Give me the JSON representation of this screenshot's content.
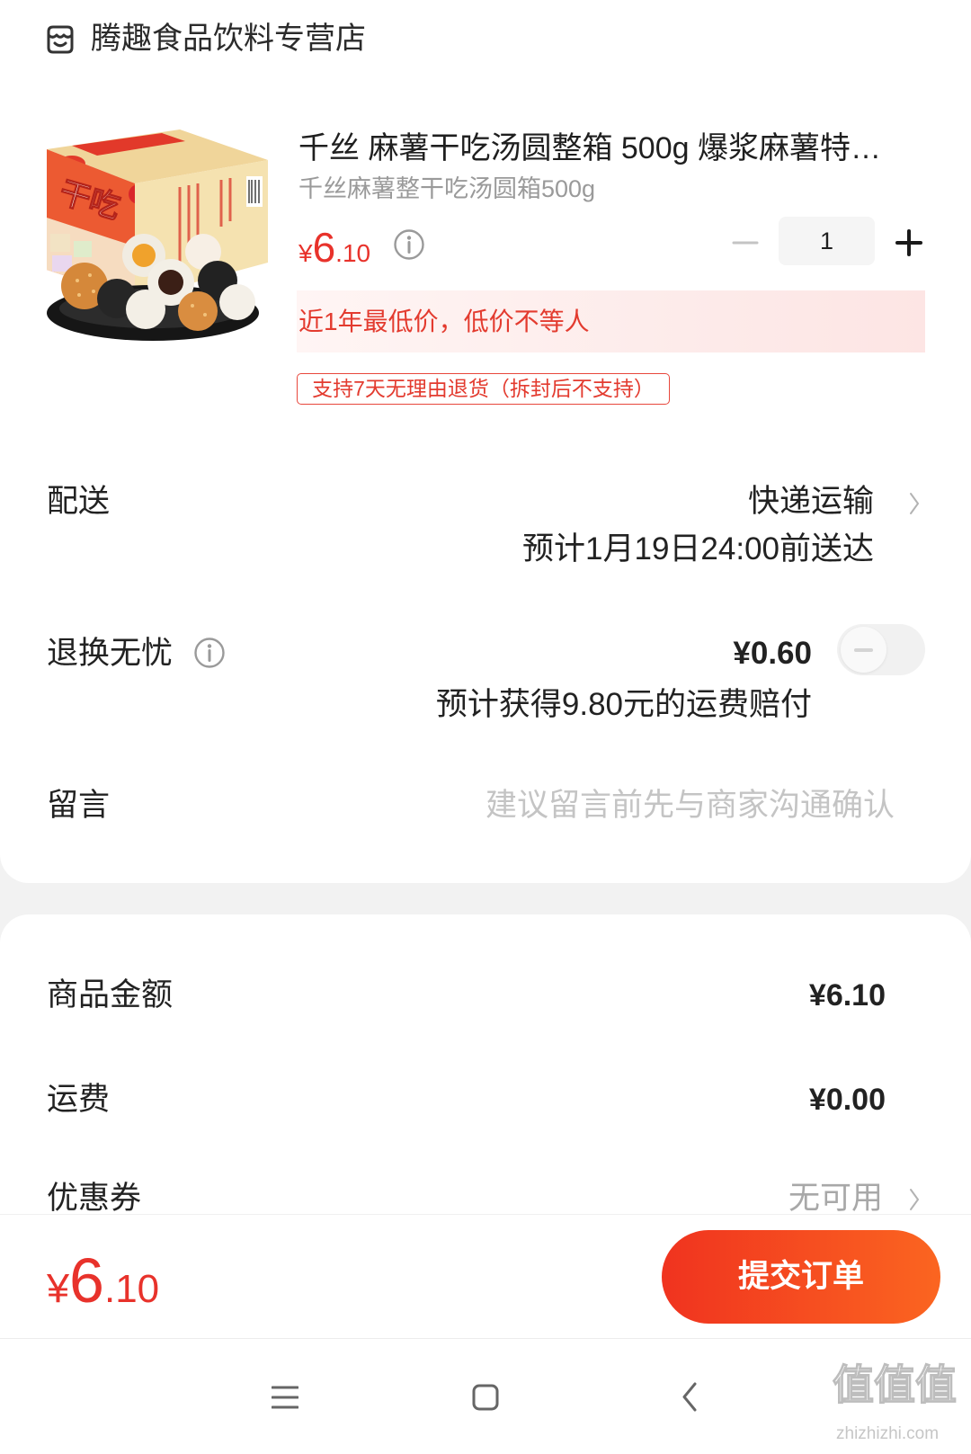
{
  "store": {
    "name": "腾趣食品饮料专营店",
    "icon": "store-icon"
  },
  "product": {
    "title": "千丝 麻薯干吃汤圆整箱 500g 爆浆麻薯特…",
    "spec": "千丝麻薯整干吃汤圆箱500g",
    "image_text": "干吃",
    "price": {
      "symbol": "¥",
      "integer": "6",
      "decimal": ".10"
    },
    "price_info_icon": "info-icon",
    "quantity": "1",
    "stepper": {
      "minus_icon": "minus-icon",
      "plus_icon": "plus-icon",
      "minus_enabled": false
    },
    "promo_banner": "近1年最低价，低价不等人",
    "return_policy_tag": "支持7天无理由退货（拆封后不支持）"
  },
  "delivery": {
    "label": "配送",
    "method": "快递运输",
    "estimate": "预计1月19日24:00前送达",
    "icon": "chevron-right-icon"
  },
  "return_insurance": {
    "label": "退换无忧",
    "info_icon": "info-icon",
    "price": "¥0.60",
    "note": "预计获得9.80元的运费赔付",
    "enabled": false
  },
  "message": {
    "label": "留言",
    "placeholder": "建议留言前先与商家沟通确认"
  },
  "summary": {
    "goods_amount": {
      "label": "商品金额",
      "value": "¥6.10"
    },
    "shipping": {
      "label": "运费",
      "value": "¥0.00"
    },
    "coupon": {
      "label": "优惠券",
      "value": "无可用",
      "icon": "chevron-right-icon"
    }
  },
  "footer": {
    "total": {
      "symbol": "¥",
      "integer": "6",
      "decimal": ".10"
    },
    "submit_label": "提交订单"
  },
  "nav_bar": {
    "icons": [
      "menu-icon",
      "home-icon",
      "back-icon"
    ]
  },
  "watermark": {
    "mark": "值值值",
    "site": "zhizhizhi.com"
  },
  "colors": {
    "accent": "#e8322b",
    "button_start": "#f0331f",
    "button_end": "#fb6520",
    "banner_start": "#fff5f4",
    "banner_end": "#fde5e4",
    "page_bg": "#f2f2f2"
  }
}
